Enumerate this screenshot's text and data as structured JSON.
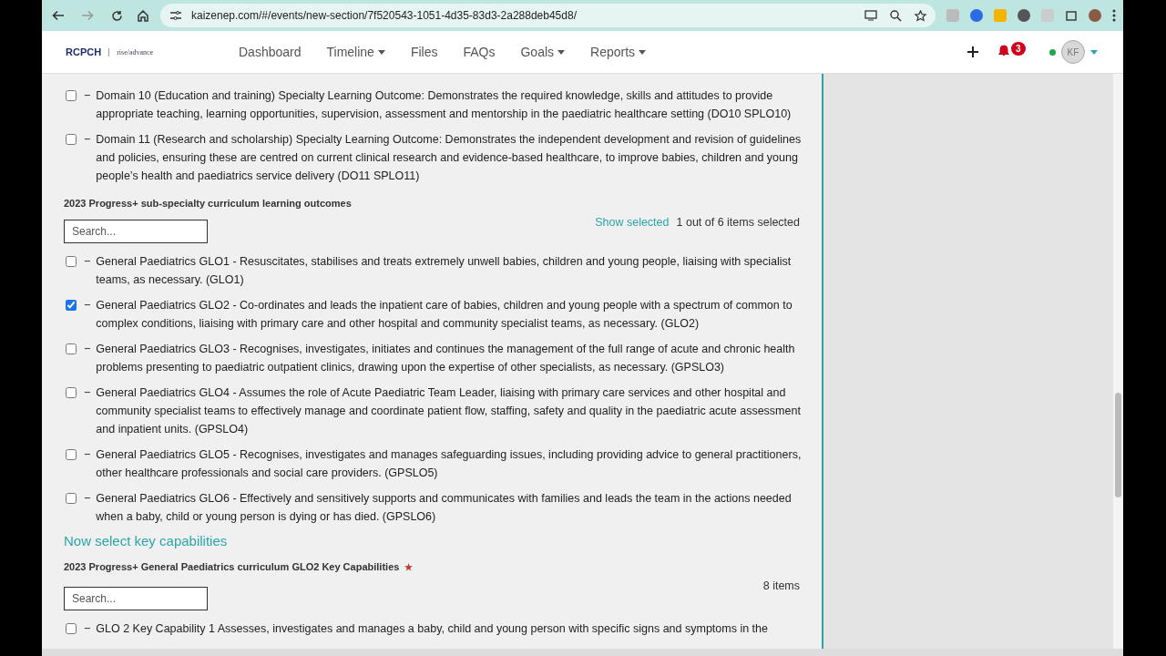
{
  "browser": {
    "url": "kaizenep.com/#/events/new-section/7f520543-1051-4d35-83d3-2a288deb45d8/"
  },
  "header": {
    "logo": {
      "brand": "RCPCH",
      "product": "rise/advance"
    },
    "nav": [
      {
        "label": "Dashboard",
        "dropdown": false
      },
      {
        "label": "Timeline",
        "dropdown": true
      },
      {
        "label": "Files",
        "dropdown": false
      },
      {
        "label": "FAQs",
        "dropdown": false
      },
      {
        "label": "Goals",
        "dropdown": true
      },
      {
        "label": "Reports",
        "dropdown": true
      }
    ],
    "notifications": "3",
    "avatar": "KF"
  },
  "domain_outcomes": [
    {
      "dash": "−",
      "text": "Domain 10 (Education and training) Specialty Learning Outcome: Demonstrates the required knowledge, skills and attitudes to provide appropriate teaching, learning opportunities, supervision, assessment and mentorship in the paediatric healthcare setting (DO10 SPLO10)",
      "checked": false
    },
    {
      "dash": "−",
      "text": "Domain 11 (Research and scholarship) Specialty Learning Outcome: Demonstrates the independent development and revision of guidelines and policies, ensuring these are centred on current clinical research and evidence-based healthcare, to improve babies, children and young people’s health and paediatrics service delivery (DO11 SPLO11)",
      "checked": false
    }
  ],
  "subspecialty": {
    "title": "2023 Progress+ sub-specialty curriculum learning outcomes",
    "search": {
      "placeholder": "Search..."
    },
    "show_selected": "Show selected",
    "count": "1 out of 6 items selected",
    "items": [
      {
        "dash": "−",
        "text": "General Paediatrics GLO1 - Resuscitates, stabilises and treats extremely unwell babies, children and young people, liaising with specialist teams, as necessary. (GLO1)",
        "checked": false
      },
      {
        "dash": "−",
        "text": "General Paediatrics GLO2 - Co-ordinates and leads the inpatient care of babies, children and young people with a spectrum of common to complex conditions, liaising with primary care and other hospital and community specialist teams, as necessary. (GLO2)",
        "checked": true
      },
      {
        "dash": "−",
        "text": "General Paediatrics GLO3 - Recognises, investigates, initiates and continues the management of the full range of acute and chronic health problems presenting to paediatric outpatient clinics, drawing upon the expertise of other specialists, as necessary. (GPSLO3)",
        "checked": false
      },
      {
        "dash": "−",
        "text": "General Paediatrics GLO4 - Assumes the role of Acute Paediatric Team Leader, liaising with primary care services and other hospital and community specialist teams to effectively manage and coordinate patient flow, staffing, safety and quality in the paediatric acute assessment and inpatient units. (GPSLO4)",
        "checked": false
      },
      {
        "dash": "−",
        "text": "General Paediatrics GLO5 - Recognises, investigates and manages safeguarding issues, including providing advice to general practitioners, other healthcare professionals and social care providers. (GPSLO5)",
        "checked": false
      },
      {
        "dash": "−",
        "text": "General Paediatrics GLO6 - Effectively and sensitively supports and communicates with families and leads the team in the actions needed when a baby, child or young person is dying or has died. (GPSLO6)",
        "checked": false
      }
    ]
  },
  "key_capabilities_heading": "Now select key capabilities",
  "key_capabilities": {
    "title": "2023 Progress+ General Paediatrics curriculum GLO2 Key Capabilities",
    "required_mark": "★",
    "search": {
      "placeholder": "Search..."
    },
    "count": "8 items",
    "items": [
      {
        "dash": "−",
        "text": "GLO 2 Key Capability 1 Assesses, investigates and manages a baby, child and young person with specific signs and symptoms in the",
        "checked": false
      }
    ]
  }
}
